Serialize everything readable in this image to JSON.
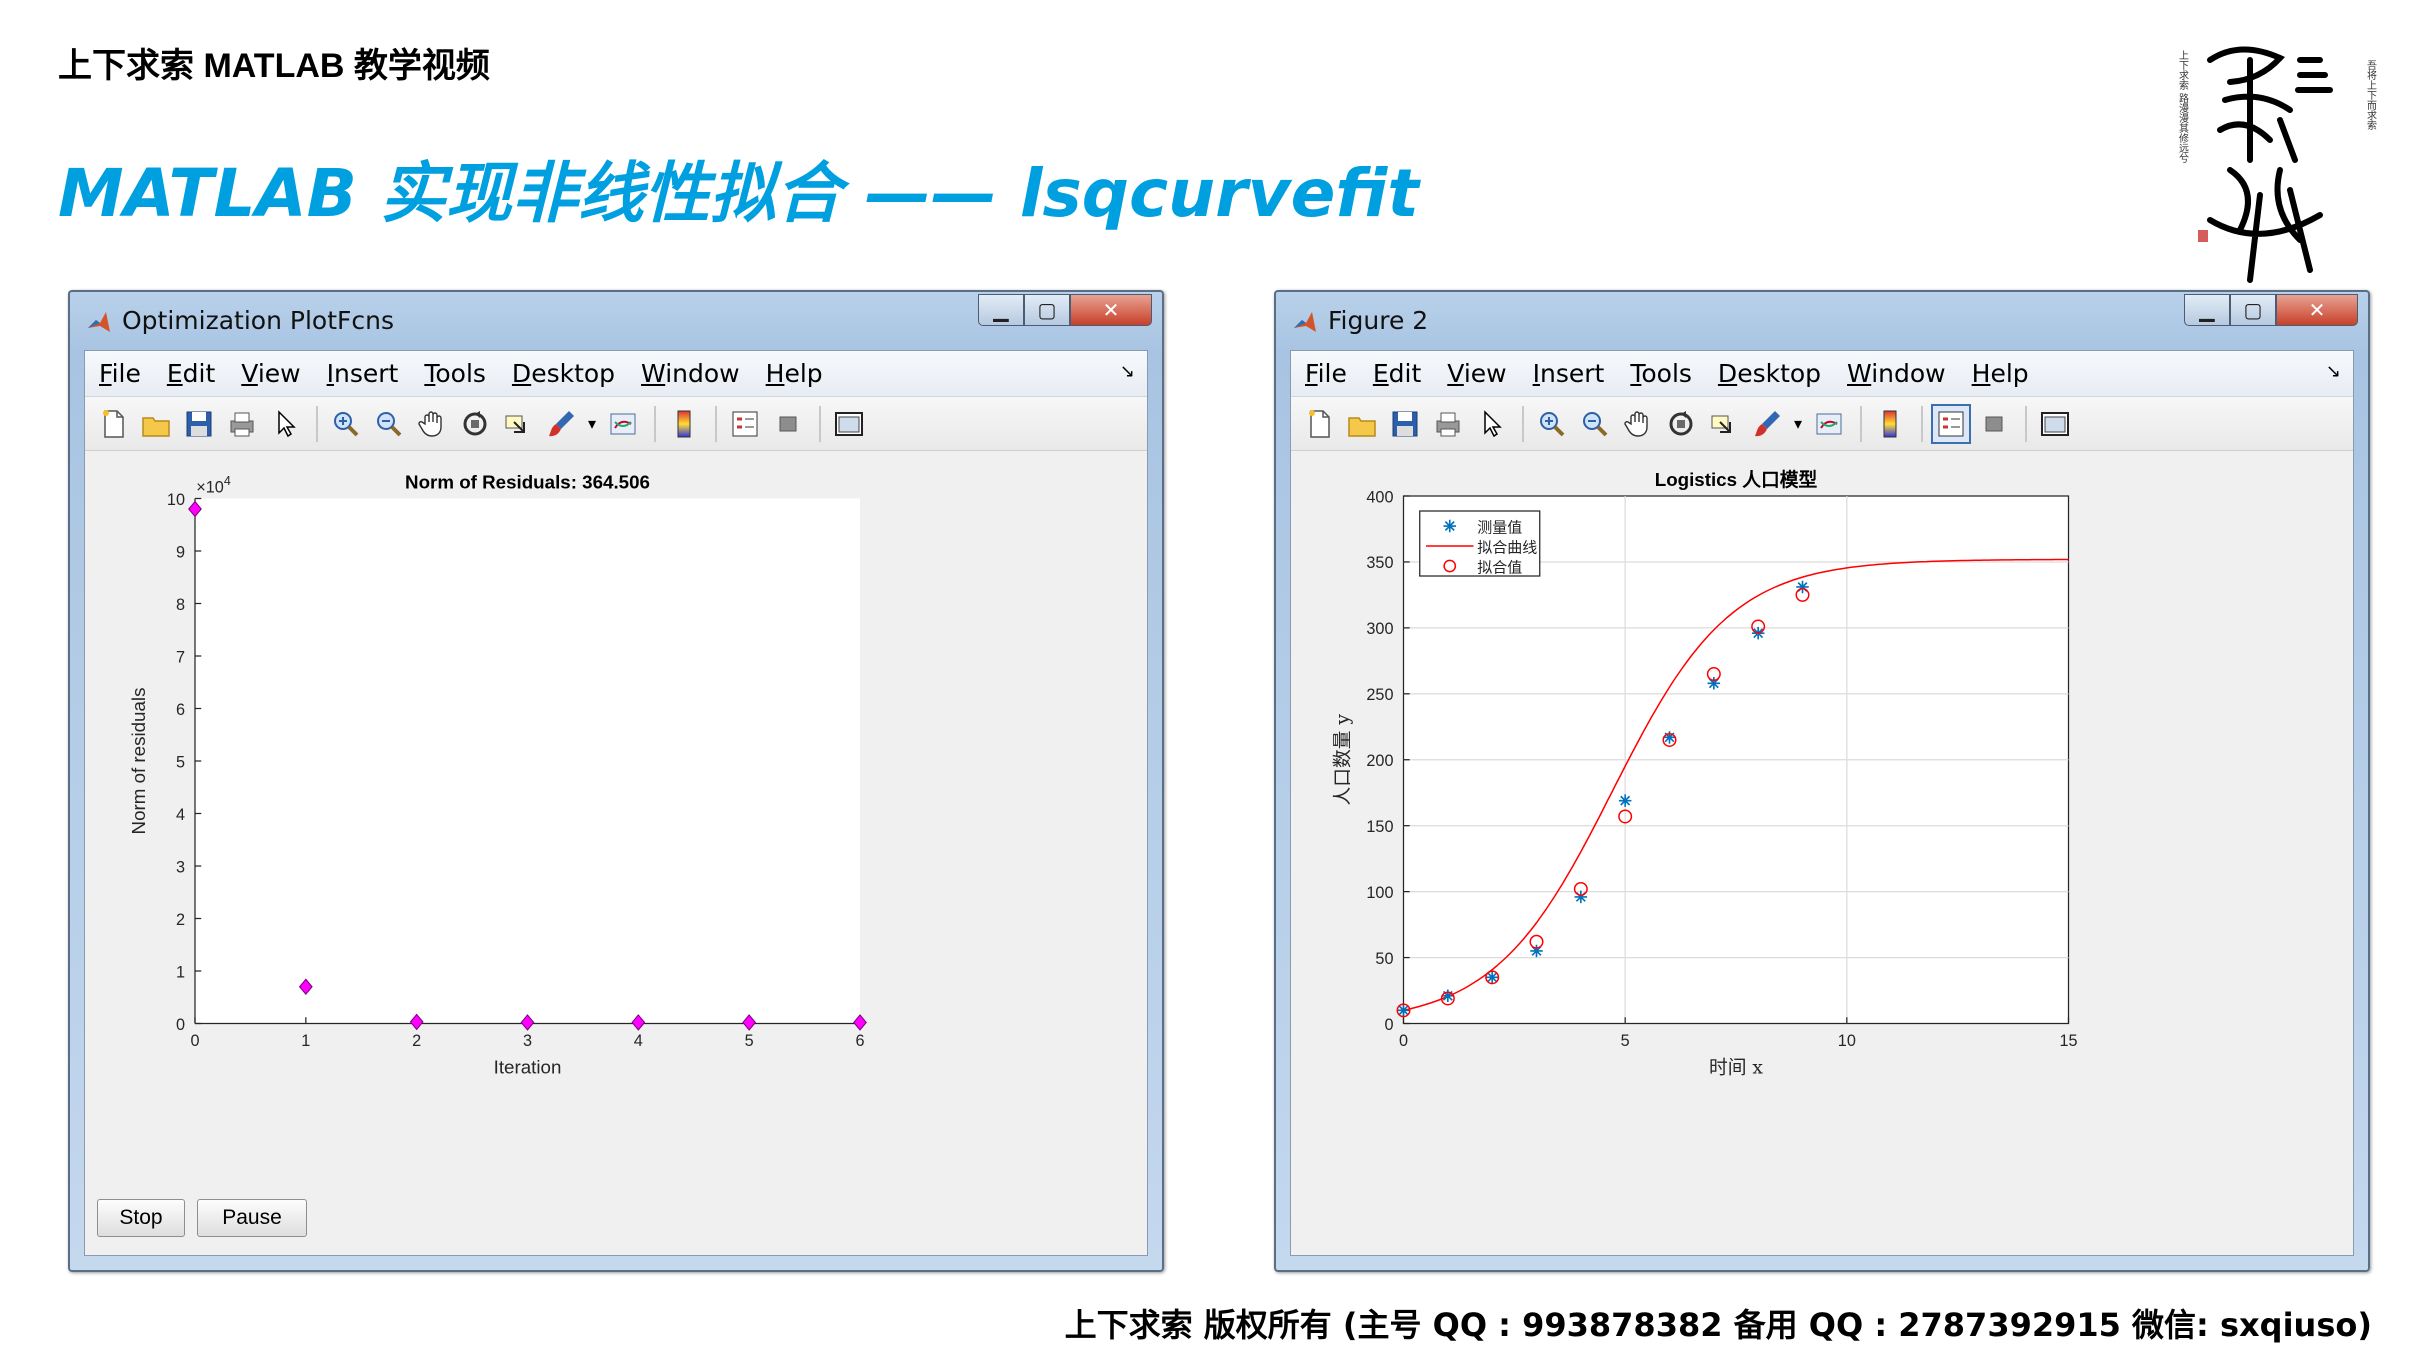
{
  "slide": {
    "header": "上下求索 MATLAB 教学视频",
    "title": "MATLAB 实现非线性拟合 —— lsqcurvefit",
    "footer": "上下求索  版权所有  (主号 QQ : 993878382   备用 QQ : 2787392915   微信: sxqiuso)"
  },
  "seal": {
    "glyph": "求索",
    "side_text_left": "上下求索 路漫漫其修远兮",
    "side_text_right": "吾将上下而求索"
  },
  "menu": [
    "File",
    "Edit",
    "View",
    "Insert",
    "Tools",
    "Desktop",
    "Window",
    "Help"
  ],
  "toolbar_icons": [
    "new-file-icon",
    "open-folder-icon",
    "save-icon",
    "print-icon",
    "pointer-icon",
    "zoom-in-icon",
    "zoom-out-icon",
    "pan-hand-icon",
    "rotate-icon",
    "data-cursor-icon",
    "brush-icon",
    "link-icon",
    "colorbar-icon",
    "legend-icon",
    "hide-tools-icon",
    "dock-icon"
  ],
  "window_left": {
    "title": "Optimization PlotFcns",
    "stop_label": "Stop",
    "pause_label": "Pause"
  },
  "window_right": {
    "title": "Figure 2"
  },
  "chart_data": [
    {
      "type": "scatter",
      "title": "Norm of Residuals: 364.506",
      "xlabel": "Iteration",
      "ylabel": "Norm of residuals",
      "exponent_label": "×10",
      "exponent_power": "4",
      "x": [
        0,
        1,
        2,
        3,
        4,
        5,
        6
      ],
      "y": [
        9.8,
        0.7,
        0.03,
        0.02,
        0.02,
        0.02,
        0.02
      ],
      "xlim": [
        0,
        6
      ],
      "ylim": [
        0,
        10
      ],
      "xticks": [
        "0",
        "1",
        "2",
        "3",
        "4",
        "5",
        "6"
      ],
      "yticks": [
        "0",
        "1",
        "2",
        "3",
        "4",
        "5",
        "6",
        "7",
        "8",
        "9",
        "10"
      ],
      "marker": "diamond",
      "marker_color": "#ff00ff",
      "grid": false
    },
    {
      "type": "line",
      "title": "Logistics 人口模型",
      "xlabel": "时间 x",
      "ylabel": "人口数量 y",
      "xlim": [
        0,
        15
      ],
      "ylim": [
        0,
        400
      ],
      "xticks": [
        "0",
        "5",
        "10",
        "15"
      ],
      "yticks": [
        "0",
        "50",
        "100",
        "150",
        "200",
        "250",
        "300",
        "350",
        "400"
      ],
      "grid": true,
      "legend_position": "top-left",
      "series": [
        {
          "name": "测量值",
          "marker": "asterisk",
          "color": "#0072bd",
          "x": [
            0,
            1,
            2,
            3,
            4,
            5,
            6,
            7,
            8,
            9
          ],
          "y": [
            10,
            21,
            35,
            55,
            96,
            169,
            217,
            258,
            296,
            331
          ]
        },
        {
          "name": "拟合曲线",
          "color": "#ff0000",
          "model": {
            "K": 352,
            "r": 0.75,
            "y0": 10
          }
        },
        {
          "name": "拟合值",
          "marker": "circle",
          "color": "#ff0000",
          "x": [
            0,
            1,
            2,
            3,
            4,
            5,
            6,
            7,
            8,
            9
          ],
          "y": [
            10,
            19,
            35,
            62,
            102,
            157,
            215,
            265,
            301,
            325
          ]
        }
      ]
    }
  ]
}
